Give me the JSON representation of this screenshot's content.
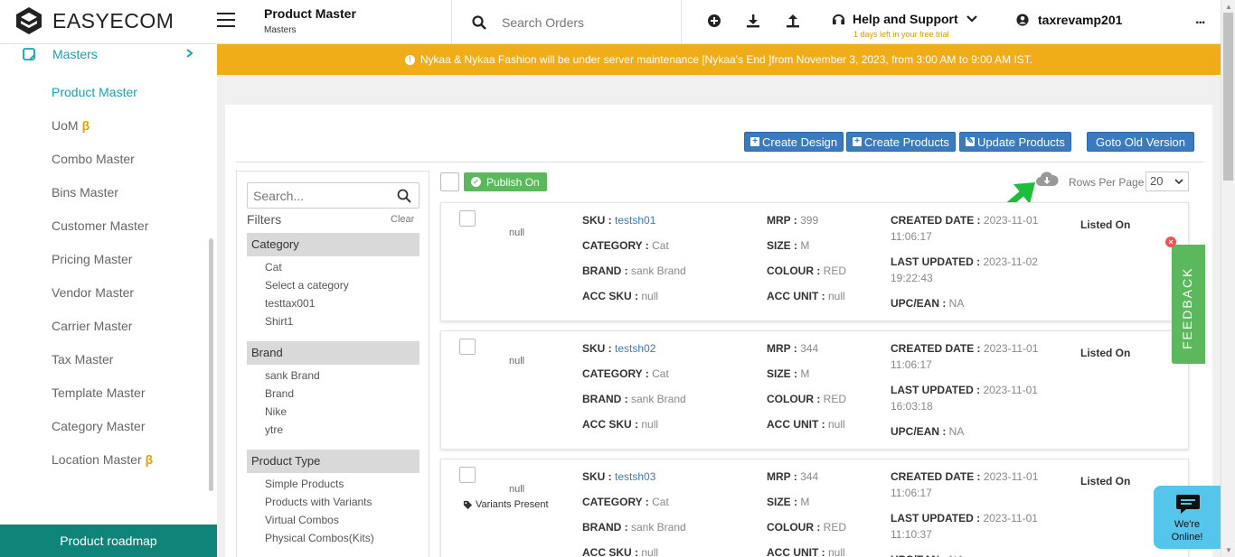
{
  "header": {
    "brand": "EASYECOM",
    "page_title": "Product Master",
    "page_subtitle": "Masters",
    "search_placeholder": "Search Orders",
    "help_label": "Help and Support",
    "trial_text": "1 days left in your free trial",
    "username": "taxrevamp201",
    "more": "..."
  },
  "sidebar": {
    "section_label": "Masters",
    "items": [
      {
        "label": "Product Master",
        "active": true
      },
      {
        "label": "UoM",
        "beta": "β"
      },
      {
        "label": "Combo Master"
      },
      {
        "label": "Bins Master"
      },
      {
        "label": "Customer Master"
      },
      {
        "label": "Pricing Master"
      },
      {
        "label": "Vendor Master"
      },
      {
        "label": "Carrier Master"
      },
      {
        "label": "Tax Master"
      },
      {
        "label": "Template Master"
      },
      {
        "label": "Category Master"
      },
      {
        "label": "Location Master",
        "beta": "β"
      }
    ],
    "roadmap_label": "Product roadmap"
  },
  "banner": {
    "text": "Nykaa & Nykaa Fashion will be under server maintenance [Nykaa's End ]from November 3, 2023, from 3:00 AM to 9:00 AM IST.",
    "color": "#f0ad18"
  },
  "actions": {
    "create_design": "Create Design",
    "create_products": "Create Products",
    "update_products": "Update Products",
    "goto_old": "Goto Old Version"
  },
  "filters": {
    "search_placeholder": "Search...",
    "title": "Filters",
    "clear": "Clear",
    "groups": [
      {
        "name": "Category",
        "options": [
          "Cat",
          "Select a category",
          "testtax001",
          "Shirt1"
        ]
      },
      {
        "name": "Brand",
        "options": [
          "sank Brand",
          "Brand",
          "Nike",
          "ytre"
        ]
      },
      {
        "name": "Product Type",
        "options": [
          "Simple Products",
          "Products with Variants",
          "Virtual Combos",
          "Physical Combos(Kits)"
        ]
      }
    ]
  },
  "toolbar": {
    "publish_label": "Publish On",
    "rows_label": "Rows Per Page",
    "rows_value": "20"
  },
  "labels": {
    "sku": "SKU : ",
    "category": "CATEGORY : ",
    "brand": "BRAND : ",
    "acc_sku": "ACC SKU : ",
    "mrp": "MRP : ",
    "size": "SIZE : ",
    "colour": "COLOUR : ",
    "acc_unit": "ACC UNIT : ",
    "created": "CREATED DATE : ",
    "updated": "LAST UPDATED : ",
    "upc": "UPC/EAN : "
  },
  "products": [
    {
      "image": "null",
      "variants": "",
      "sku": "testsh01",
      "category": "Cat",
      "brand": "sank Brand",
      "acc_sku": "null",
      "mrp": "399",
      "size": "M",
      "colour": "RED",
      "acc_unit": "null",
      "created_a": "2023-11-01",
      "created_b": "11:06:17",
      "updated_a": "2023-11-02",
      "updated_b": "19:22:43",
      "upc": "NA",
      "status": "Listed On"
    },
    {
      "image": "null",
      "variants": "",
      "sku": "testsh02",
      "category": "Cat",
      "brand": "sank Brand",
      "acc_sku": "null",
      "mrp": "344",
      "size": "M",
      "colour": "RED",
      "acc_unit": "null",
      "created_a": "2023-11-01",
      "created_b": "11:06:17",
      "updated_a": "2023-11-01",
      "updated_b": "16:03:18",
      "upc": "NA",
      "status": "Listed On"
    },
    {
      "image": "null",
      "variants": "Variants Present",
      "sku": "testsh03",
      "category": "Cat",
      "brand": "sank Brand",
      "acc_sku": "null",
      "mrp": "344",
      "size": "M",
      "colour": "RED",
      "acc_unit": "null",
      "created_a": "2023-11-01",
      "created_b": "11:06:17",
      "updated_a": "2023-11-01",
      "updated_b": "11:10:37",
      "upc": "NA",
      "status": "Listed On"
    }
  ],
  "feedback_label": "FEEDBACK",
  "chat": {
    "line1": "We're",
    "line2": "Online!"
  }
}
